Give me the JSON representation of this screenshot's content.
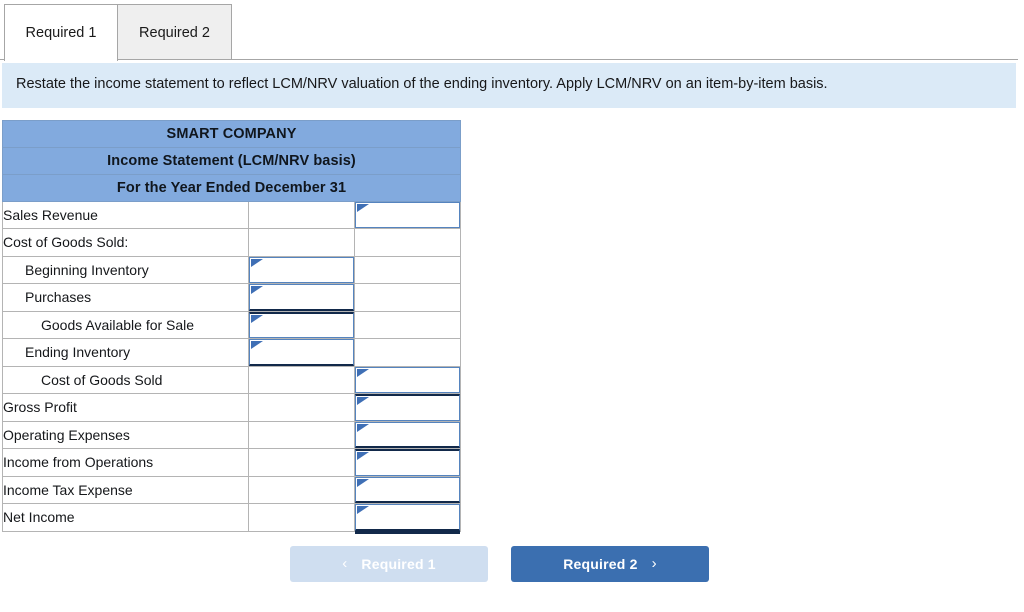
{
  "tabs": [
    {
      "label": "Required 1",
      "state": "active"
    },
    {
      "label": "Required 2",
      "state": "inactive"
    }
  ],
  "instruction": {
    "text": "Restate the income statement to reflect LCM/NRV valuation of the ending inventory. Apply LCM/NRV on an item-by-item basis."
  },
  "worksheet": {
    "headers": [
      "SMART COMPANY",
      "Income Statement (LCM/NRV basis)",
      "For the Year Ended December 31"
    ],
    "rows": [
      {
        "label": "Sales Revenue",
        "indent": 0,
        "mid": "none",
        "right": "input"
      },
      {
        "label": "Cost of Goods Sold:",
        "indent": 0,
        "mid": "none",
        "right": "none"
      },
      {
        "label": "Beginning Inventory",
        "indent": 1,
        "mid": "input",
        "right": "none"
      },
      {
        "label": "Purchases",
        "indent": 1,
        "mid": "input-bd",
        "right": "none"
      },
      {
        "label": "Goods Available for Sale",
        "indent": 2,
        "mid": "input-td",
        "right": "none"
      },
      {
        "label": "Ending Inventory",
        "indent": 1,
        "mid": "input-bd",
        "right": "none"
      },
      {
        "label": "Cost of Goods Sold",
        "indent": 2,
        "mid": "none",
        "right": "input"
      },
      {
        "label": "Gross Profit",
        "indent": 0,
        "mid": "none",
        "right": "input-td"
      },
      {
        "label": "Operating Expenses",
        "indent": 0,
        "mid": "none",
        "right": "input-bd"
      },
      {
        "label": "Income from Operations",
        "indent": 0,
        "mid": "none",
        "right": "input-td"
      },
      {
        "label": "Income Tax Expense",
        "indent": 0,
        "mid": "none",
        "right": "input-bd"
      },
      {
        "label": "Net Income",
        "indent": 0,
        "mid": "none",
        "right": "input-double"
      }
    ]
  },
  "footer": {
    "prev": {
      "label": "Required 1",
      "icon": "chevron-left-icon",
      "glyph": "‹",
      "enabled": false
    },
    "next": {
      "label": "Required 2",
      "icon": "chevron-right-icon",
      "glyph": "›",
      "enabled": true
    }
  },
  "colors": {
    "header_blue": "#82aade",
    "banner_blue": "#dbeaf7",
    "primary_button": "#3b6fb0",
    "disabled_button": "#cfdef0",
    "cell_border_blue": "#5584bf",
    "total_rule_navy": "#12294a"
  }
}
